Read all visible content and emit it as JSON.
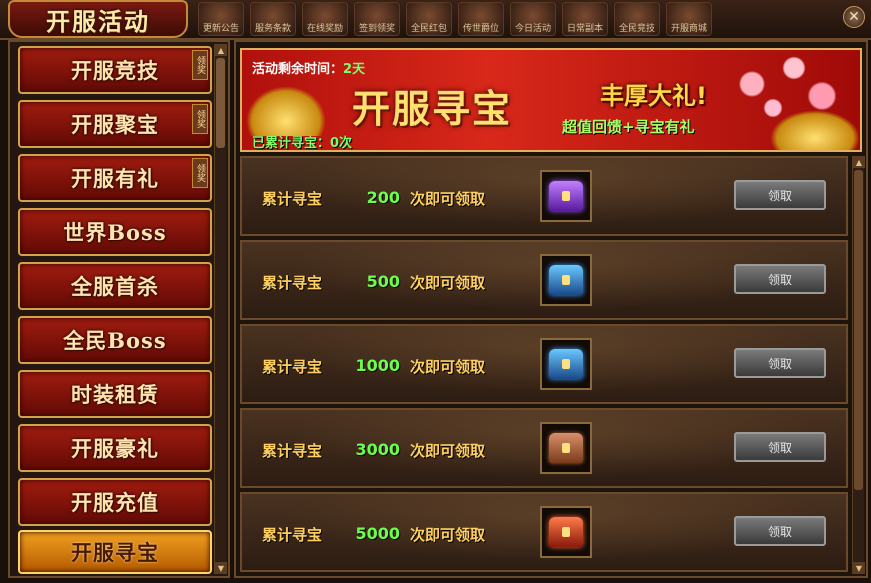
{
  "window": {
    "title": "开服活动",
    "close_icon": "close-icon"
  },
  "top_tabs": [
    {
      "label": "更新公告"
    },
    {
      "label": "服务条款"
    },
    {
      "label": "在线奖励"
    },
    {
      "label": "签到领奖"
    },
    {
      "label": "全民红包"
    },
    {
      "label": "传世爵位"
    },
    {
      "label": "今日活动"
    },
    {
      "label": "日常副本"
    },
    {
      "label": "全民竞技"
    },
    {
      "label": "开服商城"
    }
  ],
  "sidebar": {
    "items": [
      {
        "label": "开服竞技",
        "badge": "领奖"
      },
      {
        "label": "开服聚宝",
        "badge": "领奖"
      },
      {
        "label": "开服有礼",
        "badge": "领奖"
      },
      {
        "label": "世界Boss",
        "badge": ""
      },
      {
        "label": "全服首杀",
        "badge": ""
      },
      {
        "label": "全民Boss",
        "badge": ""
      },
      {
        "label": "时装租赁",
        "badge": ""
      },
      {
        "label": "开服豪礼",
        "badge": ""
      },
      {
        "label": "开服充值",
        "badge": ""
      },
      {
        "label": "开服寻宝",
        "badge": "",
        "active": true
      }
    ]
  },
  "banner": {
    "remain_label": "活动剩余时间：",
    "remain_value": "2天",
    "title": "开服寻宝",
    "gift": "丰厚大礼!",
    "gift_sub": "超值回馈+寻宝有礼",
    "count_text": "已累计寻宝：0次"
  },
  "rewards": [
    {
      "label": "累计寻宝",
      "times": "200",
      "suffix": "次即可领取",
      "chest": "purple",
      "button": "领取"
    },
    {
      "label": "累计寻宝",
      "times": "500",
      "suffix": "次即可领取",
      "chest": "blue",
      "button": "领取"
    },
    {
      "label": "累计寻宝",
      "times": "1000",
      "suffix": "次即可领取",
      "chest": "blue",
      "button": "领取"
    },
    {
      "label": "累计寻宝",
      "times": "3000",
      "suffix": "次即可领取",
      "chest": "brown",
      "button": "领取"
    },
    {
      "label": "累计寻宝",
      "times": "5000",
      "suffix": "次即可领取",
      "chest": "red",
      "button": "领取"
    }
  ]
}
